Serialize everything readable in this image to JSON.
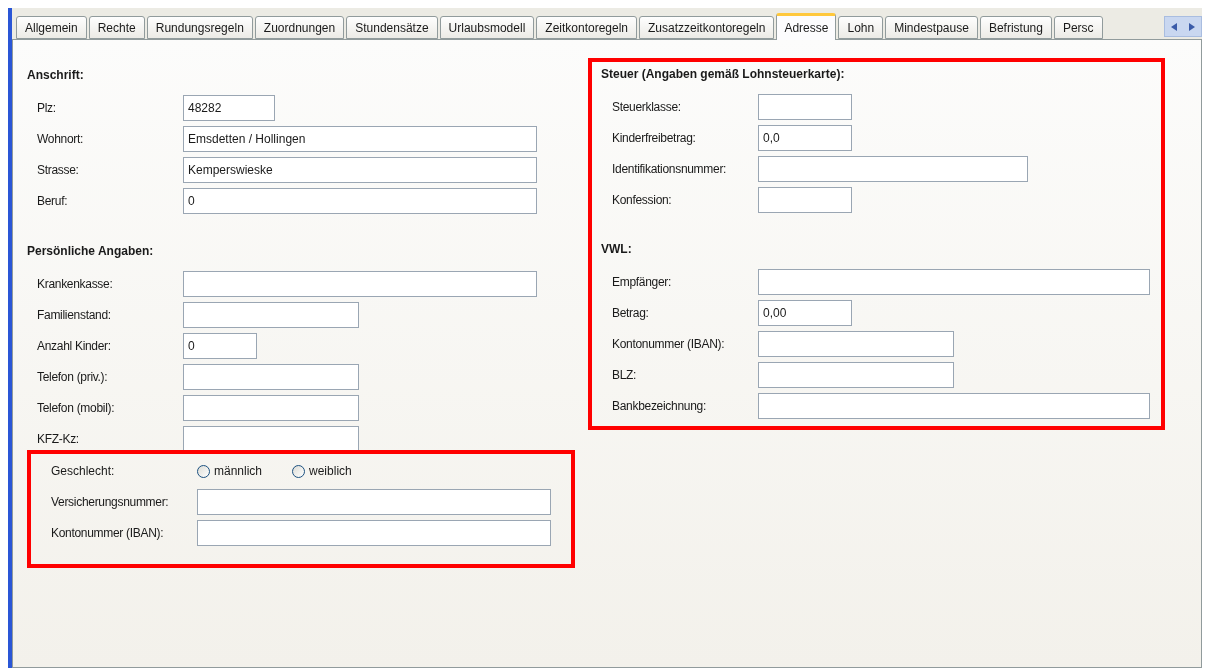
{
  "tabs": [
    {
      "label": "Allgemein",
      "selected": false
    },
    {
      "label": "Rechte",
      "selected": false
    },
    {
      "label": "Rundungsregeln",
      "selected": false
    },
    {
      "label": "Zuordnungen",
      "selected": false
    },
    {
      "label": "Stundensätze",
      "selected": false
    },
    {
      "label": "Urlaubsmodell",
      "selected": false
    },
    {
      "label": "Zeitkontoregeln",
      "selected": false
    },
    {
      "label": "Zusatzzeitkontoregeln",
      "selected": false
    },
    {
      "label": "Adresse",
      "selected": true
    },
    {
      "label": "Lohn",
      "selected": false
    },
    {
      "label": "Mindestpause",
      "selected": false
    },
    {
      "label": "Befristung",
      "selected": false
    },
    {
      "label": "Persc",
      "selected": false
    }
  ],
  "anschrift": {
    "title": "Anschrift:",
    "fields": [
      {
        "label": "Plz:",
        "value": "48282"
      },
      {
        "label": "Wohnort:",
        "value": "Emsdetten / Hollingen"
      },
      {
        "label": "Strasse:",
        "value": "Kemperswieske"
      },
      {
        "label": "Beruf:",
        "value": "0"
      }
    ]
  },
  "persoenliche_angaben": {
    "title": "Persönliche Angaben:",
    "fields": [
      {
        "label": "Krankenkasse:"
      },
      {
        "label": "Familienstand:"
      },
      {
        "label": "Anzahl Kinder:",
        "value": "0"
      },
      {
        "label": "Telefon (priv.):"
      },
      {
        "label": "Telefon (mobil):"
      },
      {
        "label": "KFZ-Kz:"
      }
    ],
    "geschlecht": {
      "label": "Geschlecht:",
      "options": [
        {
          "label": "männlich",
          "selected": false
        },
        {
          "label": "weiblich",
          "selected": false
        }
      ]
    },
    "extra_fields": [
      {
        "label": "Versicherungsnummer:"
      },
      {
        "label": "Kontonummer (IBAN):"
      }
    ]
  },
  "steuer": {
    "title": "Steuer (Angaben gemäß Lohnsteuerkarte):",
    "fields": [
      {
        "label": "Steuerklasse:"
      },
      {
        "label": "Kinderfreibetrag:",
        "value": "0,0"
      },
      {
        "label": "Identifikationsnummer:"
      },
      {
        "label": "Konfession:"
      }
    ]
  },
  "vwl": {
    "title": "VWL:",
    "fields": [
      {
        "label": "Empfänger:"
      },
      {
        "label": "Betrag:",
        "value": "0,00"
      },
      {
        "label": "Kontonummer (IBAN):"
      },
      {
        "label": "BLZ:"
      },
      {
        "label": "Bankbezeichnung:"
      }
    ]
  }
}
